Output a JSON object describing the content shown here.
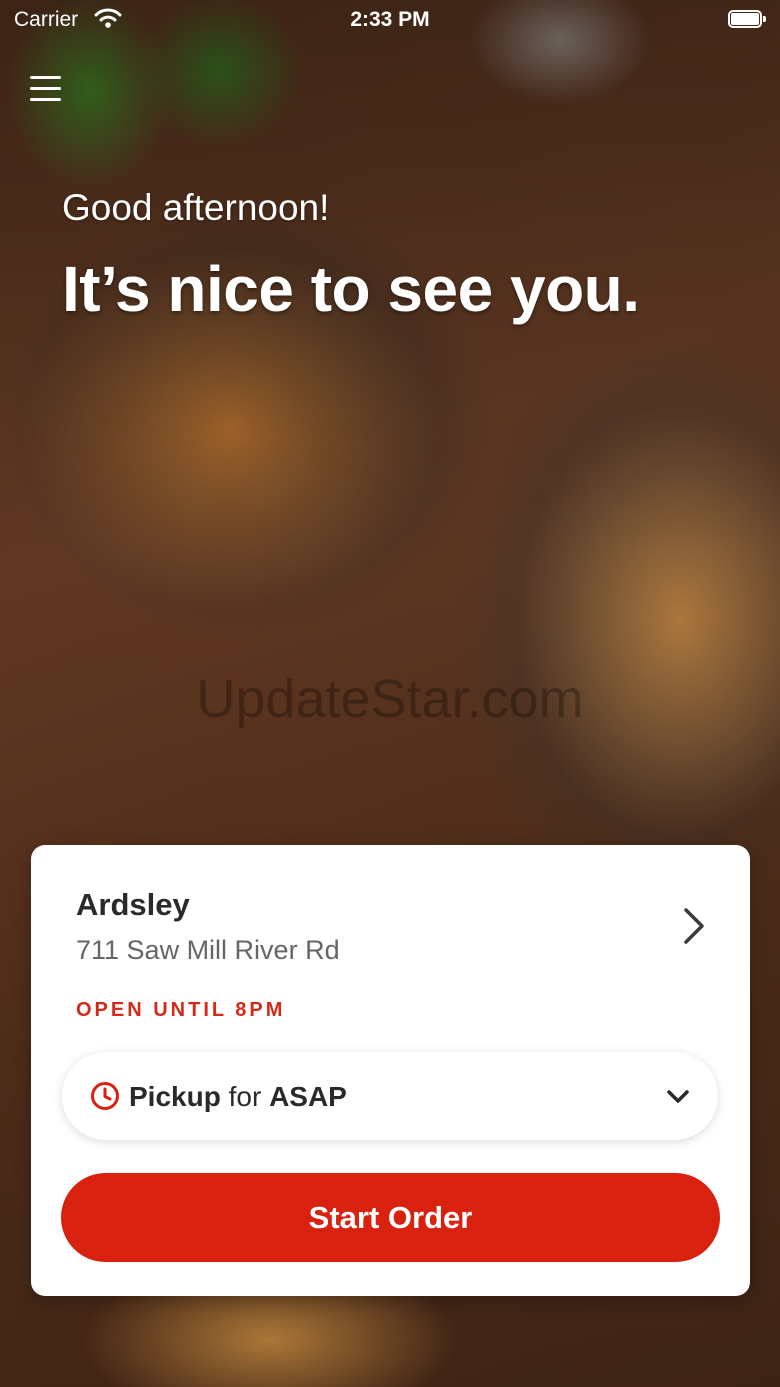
{
  "status_bar": {
    "carrier": "Carrier",
    "time": "2:33 PM",
    "wifi_icon": "wifi-icon",
    "battery_icon": "battery-icon"
  },
  "header": {
    "menu_icon": "hamburger-menu-icon",
    "greeting": "Good afternoon!",
    "welcome": "It’s nice to see you."
  },
  "watermark": "UpdateStar.com",
  "store": {
    "name": "Ardsley",
    "address": "711 Saw Mill River Rd",
    "hours": "OPEN UNTIL 8PM",
    "chevron_icon": "chevron-right-icon"
  },
  "order_mode": {
    "icon": "clock-icon",
    "mode": "Pickup",
    "connector": "for",
    "time": "ASAP",
    "dropdown_icon": "chevron-down-icon"
  },
  "actions": {
    "start_order": "Start Order"
  },
  "colors": {
    "brand_red": "#d8210f",
    "hours_red": "#d42a1a",
    "text_dark": "#2a2a2a",
    "text_gray": "#666666"
  }
}
